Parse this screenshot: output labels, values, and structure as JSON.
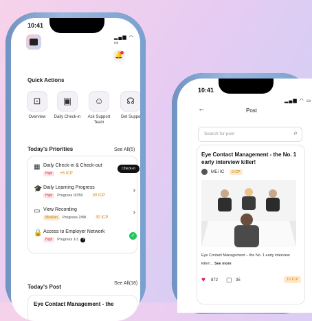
{
  "left_phone": {
    "status_time": "10:41",
    "quick_actions": {
      "title": "Quick Actions",
      "items": [
        {
          "label": "Overview",
          "icon": "overview-icon"
        },
        {
          "label": "Daily Check-in",
          "icon": "calendar-check-icon"
        },
        {
          "label": "Ask Support Team",
          "icon": "support-team-icon"
        },
        {
          "label": "Get Suppo",
          "icon": "headset-icon"
        }
      ]
    },
    "priorities": {
      "title": "Today's Priorities",
      "see_all": "See All(5)",
      "tasks": [
        {
          "title": "Daily Check-in & Check-out",
          "badge": "High",
          "icp": "+5 ICP",
          "progress": "",
          "action": "Check-in"
        },
        {
          "title": "Daily Learning Progress",
          "badge": "High",
          "progress": "Progress 0/350",
          "icp": "30 ICP"
        },
        {
          "title": "View Recording",
          "badge": "Medium",
          "progress": "Progress 2/88",
          "icp": "30 ICP"
        },
        {
          "title": "Access to Employer Network",
          "badge": "High",
          "progress": "Progress 1/1",
          "icp": ""
        }
      ]
    },
    "todays_post": {
      "title": "Today's Post",
      "see_all": "See All(18)",
      "preview": "Eye Contact Management - the"
    }
  },
  "right_phone": {
    "status_time": "10:41",
    "header": "Post",
    "search_placeholder": "Search for post",
    "post": {
      "title": "Eye Contact Management - the No. 1 early interview killer!",
      "author": "MEi IC",
      "author_icp": "5 ICP",
      "excerpt": "Eye Contact Management – the No. 1 early interview killer!...",
      "see_more": "See more",
      "likes": "872",
      "comments": "35",
      "icp": "10 ICP"
    }
  },
  "colors": {
    "accent_orange": "#e47a00",
    "high": "#d33",
    "like": "#e11d48",
    "done": "#22c55e"
  }
}
